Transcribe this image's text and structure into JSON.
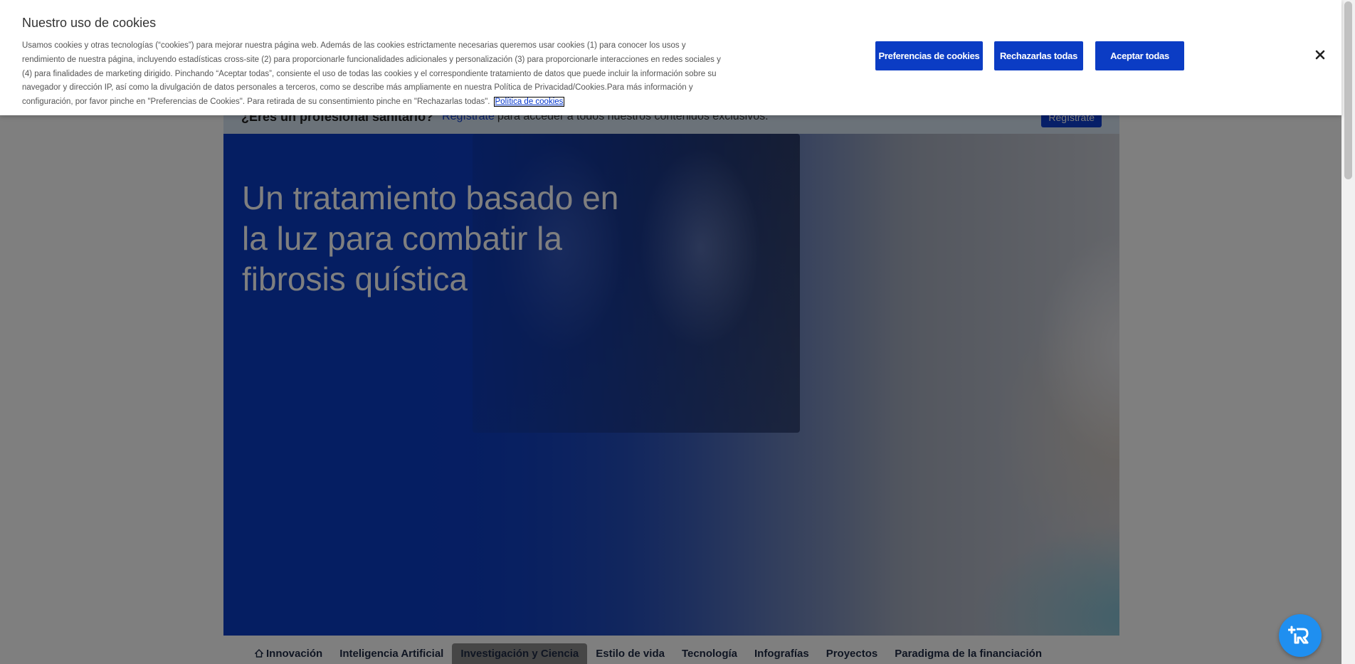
{
  "cookie_banner": {
    "title": "Nuestro uso de cookies",
    "body": "Usamos cookies y otras tecnologías (“cookies”) para mejorar nuestra página web. Además de las cookies estrictamente necesarias queremos usar cookies (1) para conocer los usos y rendimiento de nuestra página, incluyendo estadísticas cross-site (2) para proporcionarle funcionalidades adicionales y personalización (3) para proporcionarle interacciones en redes sociales y (4) para finalidades de marketing dirigido. Pinchando “Aceptar todas”, consiente el uso de todas las cookies y el correspondiente tratamiento de datos que puede incluir la información sobre su navegador y dirección IP, así como la divulgación de datos personales a terceros, como se describe más ampliamente en nuestra Política de Privacidad/Cookies.Para más información y configuración, por favor pinche en \"Preferencias de Cookies\". Para retirada de su consentimiento pinche en \"Rechazarlas todas\".",
    "policy_link": "Política de cookies",
    "preferences_button": "Preferencias de cookies",
    "reject_button": "Rechazarlas todas",
    "accept_button": "Aceptar todas",
    "close_icon": "close-icon"
  },
  "pro_banner": {
    "question": "¿Eres un profesional sanitario?",
    "link": "Regístrate",
    "rest": "para acceder a todos nuestros contenidos exclusivos.",
    "button": "Regístrate"
  },
  "hero": {
    "title": "Un tratamiento basado en la luz para combatir la fibrosis quística"
  },
  "nav": {
    "items": [
      {
        "label": "Innovación",
        "icon": "home-icon"
      },
      {
        "label": "Inteligencia Artificial"
      },
      {
        "label": "Investigación y Ciencia",
        "active": true
      },
      {
        "label": "Estilo de vida"
      },
      {
        "label": "Tecnología"
      },
      {
        "label": "Infografías"
      },
      {
        "label": "Proyectos"
      },
      {
        "label": "Paradigma de la financiación"
      }
    ]
  },
  "colors": {
    "accent": "#0b3cc4",
    "fab": "#1f8ff0"
  }
}
